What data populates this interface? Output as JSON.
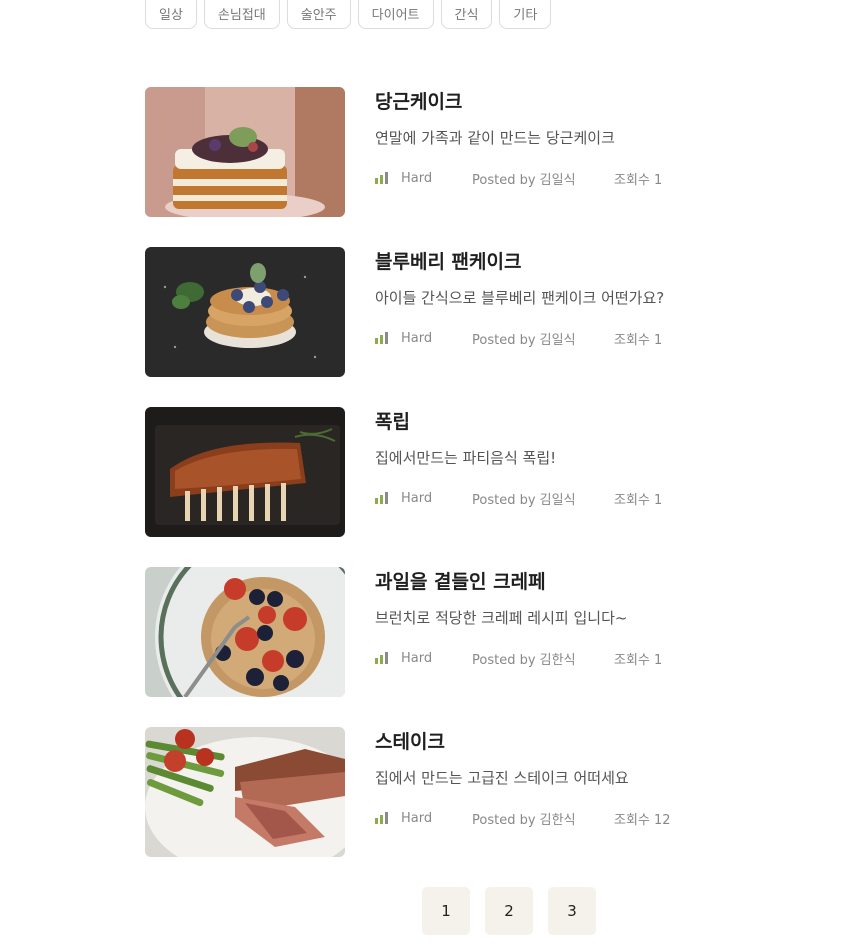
{
  "categories": [
    "일상",
    "손님접대",
    "술안주",
    "다이어트",
    "간식",
    "기타"
  ],
  "recipes": [
    {
      "title": "당근케이크",
      "desc": "연말에 가족과 같이 만드는 당근케이크",
      "level": "Hard",
      "posted": "Posted by 김일식",
      "views": "조회수 1",
      "image": "carrot-cake"
    },
    {
      "title": "블루베리 팬케이크",
      "desc": "아이들 간식으로 블루베리 팬케이크 어떤가요?",
      "level": "Hard",
      "posted": "Posted by 김일식",
      "views": "조회수 1",
      "image": "blueberry-pancake"
    },
    {
      "title": "폭립",
      "desc": "집에서만드는 파티음식 폭립!",
      "level": "Hard",
      "posted": "Posted by 김일식",
      "views": "조회수 1",
      "image": "pork-ribs"
    },
    {
      "title": "과일을 곁들인 크레페",
      "desc": "브런치로 적당한 크레페 레시피 입니다~",
      "level": "Hard",
      "posted": "Posted by 김한식",
      "views": "조회수 1",
      "image": "fruit-crepe"
    },
    {
      "title": "스테이크",
      "desc": "집에서 만드는 고급진 스테이크 어떠세요",
      "level": "Hard",
      "posted": "Posted by 김한식",
      "views": "조회수 12",
      "image": "steak"
    }
  ],
  "pagination": [
    "1",
    "2",
    "3"
  ],
  "colors": {
    "level_bar": "#8cab4b",
    "page_bg": "#f5f2ec"
  },
  "icons": {
    "level": "difficulty-bars-icon"
  }
}
